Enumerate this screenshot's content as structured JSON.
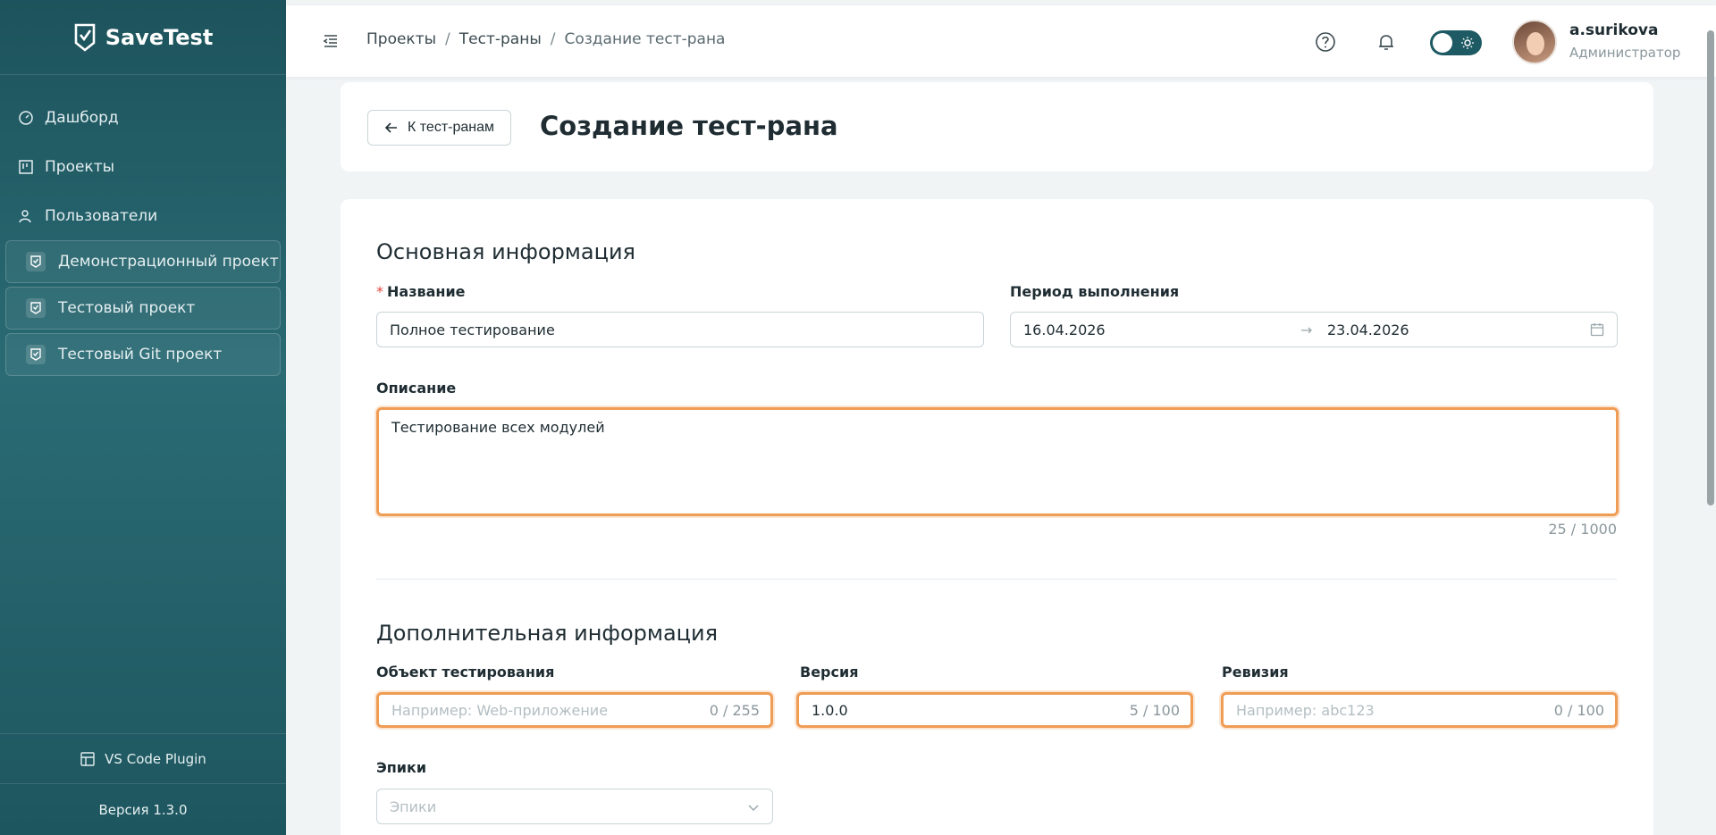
{
  "app": {
    "name": "SaveTest"
  },
  "sidebar": {
    "nav": [
      {
        "label": "Дашборд",
        "icon": "dashboard-icon"
      },
      {
        "label": "Проекты",
        "icon": "kanban-icon"
      },
      {
        "label": "Пользователи",
        "icon": "users-icon"
      }
    ],
    "projects": [
      {
        "label": "Демонстрационный проект"
      },
      {
        "label": "Тестовый проект"
      },
      {
        "label": "Тестовый Git проект"
      }
    ],
    "plugin_label": "VS Code Plugin",
    "version_label": "Версия 1.3.0"
  },
  "header": {
    "breadcrumb": {
      "item1": "Проекты",
      "sep": "/",
      "item2": "Тест-раны",
      "current": "Создание тест-рана"
    },
    "user": {
      "name": "a.surikova",
      "role": "Администратор"
    }
  },
  "page": {
    "back_label": "К тест-ранам",
    "title": "Создание тест-рана"
  },
  "form": {
    "main_section": "Основная информация",
    "name": {
      "required_mark": "*",
      "label": "Название",
      "value": "Полное тестирование"
    },
    "period": {
      "label": "Период выполнения",
      "start": "16.04.2026",
      "arrow": "→",
      "end": "23.04.2026"
    },
    "description": {
      "label": "Описание",
      "value": "Тестирование всех модулей",
      "counter": "25 / 1000"
    },
    "extra_section": "Дополнительная информация",
    "test_object": {
      "label": "Объект тестирования",
      "placeholder": "Например: Web-приложение",
      "counter": "0 / 255"
    },
    "version": {
      "label": "Версия",
      "value": "1.0.0",
      "counter": "5 / 100"
    },
    "revision": {
      "label": "Ревизия",
      "placeholder": "Например: abc123",
      "counter": "0 / 100"
    },
    "epics": {
      "label": "Эпики",
      "placeholder": "Эпики"
    }
  },
  "colors": {
    "sidebar": "#1d535c",
    "accent": "#1e5a63",
    "highlight": "#ef9c55",
    "required": "#e0463e"
  }
}
